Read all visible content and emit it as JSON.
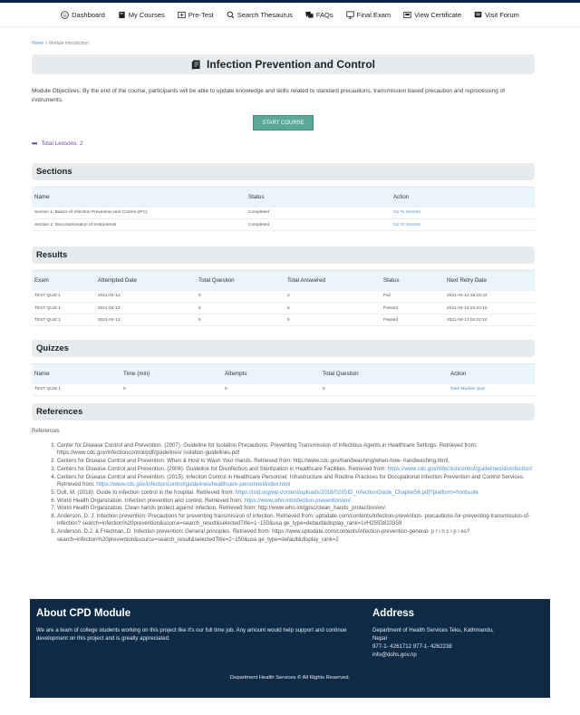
{
  "nav": [
    {
      "icon": "smile-icon",
      "label": "Dashboard"
    },
    {
      "icon": "book-icon",
      "label": "My Courses"
    },
    {
      "icon": "pretest-icon",
      "label": "Pre-Test"
    },
    {
      "icon": "search-icon",
      "label": "Search Thesaurus"
    },
    {
      "icon": "faq-icon",
      "label": "FAQs"
    },
    {
      "icon": "monitor-icon",
      "label": "Final Exam"
    },
    {
      "icon": "certificate-icon",
      "label": "View Certificate"
    },
    {
      "icon": "forum-icon",
      "label": "Visit Forum"
    }
  ],
  "breadcrumb": {
    "home": "Home",
    "separator": ">",
    "current": "Module Introduction"
  },
  "page_title": "Infection Prevention and Control",
  "objectives": "Module Objectives: By the end of the course, participants will be able to update knowledge and skills related to standard precautions, transmission based precaution and reprocessing of instruments.",
  "start_button": "START COURSE",
  "total_lessons": "Total Lessons: 2",
  "sections": {
    "title": "Sections",
    "headers": [
      "Name",
      "Status",
      "Action"
    ],
    "rows": [
      [
        "Section 1: Basics of Infection Prevention and Control (IPC)",
        "Completed",
        "Go To Section"
      ],
      [
        "Section 2: Decontamination of Instruments",
        "Completed",
        "Go To Section"
      ]
    ]
  },
  "results": {
    "title": "Results",
    "headers": [
      "Exam",
      "Attempted Date",
      "Total Question",
      "Total Answered",
      "Status",
      "Next Retry Date"
    ],
    "rows": [
      [
        "TEST QUIZ 1",
        "2021-04-12",
        "5",
        "2",
        "Fail",
        "2021-04-12 16:16:22"
      ],
      [
        "TEST QUIZ 1",
        "2021-04-13",
        "5",
        "5",
        "Passed",
        "2021-04-13 04:24:15"
      ],
      [
        "TEST QUIZ 1",
        "2021-04-13",
        "5",
        "5",
        "Passed",
        "2021-04-13 04:27:10"
      ]
    ]
  },
  "quizzes": {
    "title": "Quizzes",
    "headers": [
      "Name",
      "Time (min)",
      "Attempts",
      "Total Question",
      "Action"
    ],
    "rows": [
      [
        "TEST QUIZ 1",
        "5",
        "5",
        "5",
        "Take Module Quiz"
      ]
    ]
  },
  "references": {
    "title": "References",
    "label": "References",
    "items": [
      {
        "text": "Center for Disease Control and Prevention. (2007). Guideline for Isolation Precautions: Preventing Transmission of Infectious Agents in Healthcare Settings. Retrieved from: https://www.cdc.gov/infectioncontrol/pdf/guidelines/ isolation-guidelines.pdf",
        "link": ""
      },
      {
        "text": "Centers for Disease Control and Prevention. When & How to Wash Your Hands. Retrieved from: http://www.cdc.gov/handwashing/when-how- handwashing.html,",
        "link": ""
      },
      {
        "text": "Centers for Disease Control and Prevention. (2008). Guideline for Disinfection and Sterilization in Healthcare Facilities. Retrieved from:",
        "link": "https://www.cdc.gov/infectioncontrol/guidelines/disinfection/"
      },
      {
        "text": "Centers for Disease Control and Prevention. (2015). Infection Control in Healthcare Personnel: Infrastructure and Routine Practices for Occupational Infection Prevention and Control Services. Retrieved from:",
        "link": "https://www.cdc.gov/infectioncontrol/guidelines/healthcare-personnel/index.html"
      },
      {
        "text": "Doll, M. (2018). Guide to infection control in the hospital. Retrieved from:",
        "link": "https://isid.org/wp-content/uploads/2018/02/ISID_InfectionGuide_Chapter56.pdf?platform=hootsuite"
      },
      {
        "text": "World Health Organization. Infection prevention and control. Retrieved from:",
        "link": "https://www.who.int/infection-prevention/en/"
      },
      {
        "text": "World Health Organization. Clean hands protect against infection. Retrieved from: http://www.who.int/gpsc/clean_hands_protection/en/.",
        "link": ""
      },
      {
        "text": "Anderson, D. J. Infection prevention: Precautions for preventing transmission of infection. Retrieved from: uptodate.com/contents/infection-prevention- precautions-for-preventing-transmission-of-infection? search=infection%20prevention&source=search_result&selectedTitle=1~150&usa ge_type=default&display_rank=1#H2593810359",
        "link": ""
      },
      {
        "text": "Anderson, D.J. & Friedman, D. Infection prevention: General principles. Retrieved from: https://www.uptodate.com/contents/infection-prevention-general- p r i n c i p l es? search=infection%20prevention&source=search_result&selectedTitle=2~150&usa ge_type=default&display_rank=2",
        "link": ""
      }
    ]
  },
  "footer": {
    "about_title": "About CPD Module",
    "about_text": "We are a team of college students working on this project like it's our full time job. Any amount would help support and continue development on this project and is greatly appreciated.",
    "address_title": "Address",
    "address_lines": [
      "Department of Health Services Teku, Kathmandu,",
      "Nepal",
      "977-1- 4261712 977-1- 4262238",
      "info@dohs.gov.np"
    ],
    "copyright": "Department Health Services © All Rights Reserved."
  }
}
